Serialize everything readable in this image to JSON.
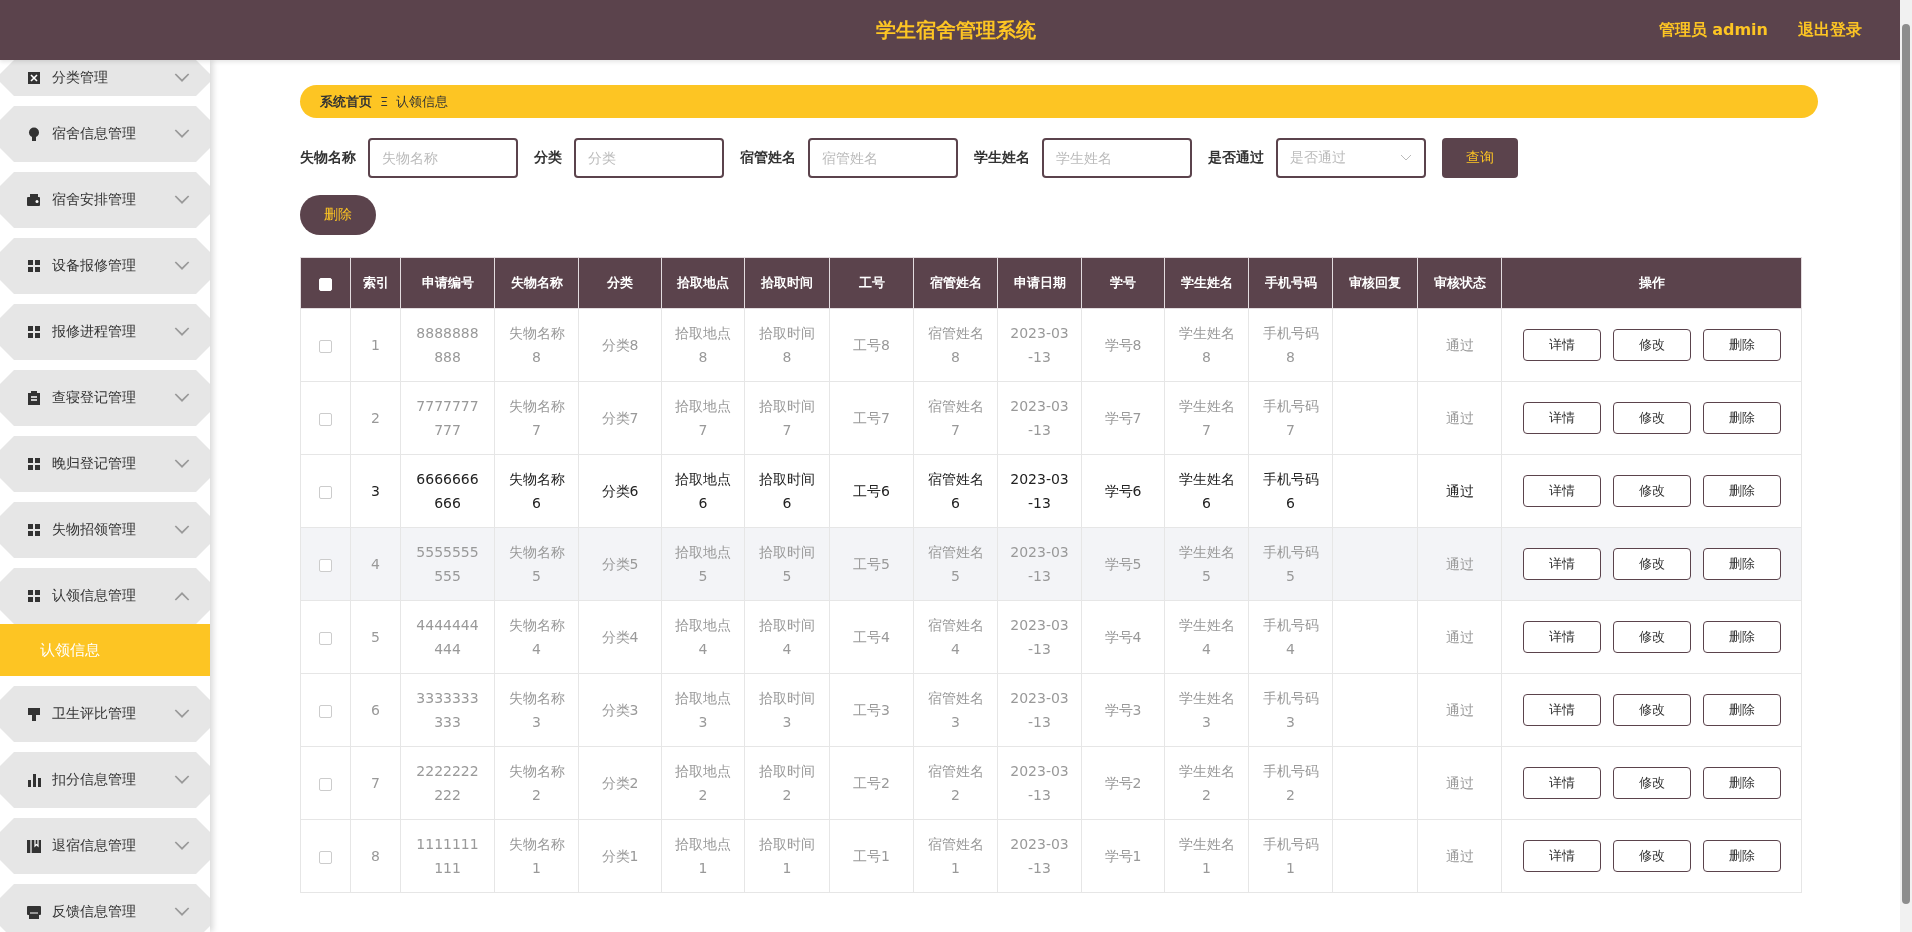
{
  "header": {
    "title": "学生宿舍管理系统",
    "user": "管理员 admin",
    "logout": "退出登录"
  },
  "sidebar": {
    "items": [
      {
        "label": "分类管理",
        "expanded": false
      },
      {
        "label": "宿舍信息管理",
        "expanded": false
      },
      {
        "label": "宿舍安排管理",
        "expanded": false
      },
      {
        "label": "设备报修管理",
        "expanded": false
      },
      {
        "label": "报修进程管理",
        "expanded": false
      },
      {
        "label": "查寝登记管理",
        "expanded": false
      },
      {
        "label": "晚归登记管理",
        "expanded": false
      },
      {
        "label": "失物招领管理",
        "expanded": false
      },
      {
        "label": "认领信息管理",
        "expanded": true,
        "children": [
          {
            "label": "认领信息",
            "selected": true
          }
        ]
      },
      {
        "label": "卫生评比管理",
        "expanded": false
      },
      {
        "label": "扣分信息管理",
        "expanded": false
      },
      {
        "label": "退宿信息管理",
        "expanded": false
      },
      {
        "label": "反馈信息管理",
        "expanded": false
      }
    ]
  },
  "breadcrumb": {
    "home": "系统首页",
    "separator": "Ξ",
    "current": "认领信息"
  },
  "filters": [
    {
      "label": "失物名称",
      "placeholder": "失物名称",
      "kind": "text"
    },
    {
      "label": "分类",
      "placeholder": "分类",
      "kind": "text"
    },
    {
      "label": "宿管姓名",
      "placeholder": "宿管姓名",
      "kind": "text"
    },
    {
      "label": "学生姓名",
      "placeholder": "学生姓名",
      "kind": "text"
    },
    {
      "label": "是否通过",
      "placeholder": "是否通过",
      "kind": "select"
    }
  ],
  "search_button": "查询",
  "delete_button": "删除",
  "table": {
    "select_all": false,
    "columns": [
      "索引",
      "申请编号",
      "失物名称",
      "分类",
      "拾取地点",
      "拾取时间",
      "工号",
      "宿管姓名",
      "申请日期",
      "学号",
      "学生姓名",
      "手机号码",
      "审核回复",
      "审核状态",
      "操作"
    ],
    "rows": [
      {
        "checked": false,
        "selected": false,
        "shaded": false,
        "cells": [
          "1",
          "8888888888",
          "失物名称8",
          "分类8",
          "拾取地点8",
          "拾取时间8",
          "工号8",
          "宿管姓名8",
          "2023-03-13",
          "学号8",
          "学生姓名8",
          "手机号码8",
          "",
          "通过"
        ],
        "actions": [
          "详情",
          "修改",
          "删除"
        ]
      },
      {
        "checked": false,
        "selected": false,
        "shaded": false,
        "cells": [
          "2",
          "7777777777",
          "失物名称7",
          "分类7",
          "拾取地点7",
          "拾取时间7",
          "工号7",
          "宿管姓名7",
          "2023-03-13",
          "学号7",
          "学生姓名7",
          "手机号码7",
          "",
          "通过"
        ],
        "actions": [
          "详情",
          "修改",
          "删除"
        ]
      },
      {
        "checked": false,
        "selected": true,
        "shaded": false,
        "cells": [
          "3",
          "6666666666",
          "失物名称6",
          "分类6",
          "拾取地点6",
          "拾取时间6",
          "工号6",
          "宿管姓名6",
          "2023-03-13",
          "学号6",
          "学生姓名6",
          "手机号码6",
          "",
          "通过"
        ],
        "actions": [
          "详情",
          "修改",
          "删除"
        ]
      },
      {
        "checked": false,
        "selected": false,
        "shaded": true,
        "cells": [
          "4",
          "5555555555",
          "失物名称5",
          "分类5",
          "拾取地点5",
          "拾取时间5",
          "工号5",
          "宿管姓名5",
          "2023-03-13",
          "学号5",
          "学生姓名5",
          "手机号码5",
          "",
          "通过"
        ],
        "actions": [
          "详情",
          "修改",
          "删除"
        ]
      },
      {
        "checked": false,
        "selected": false,
        "shaded": false,
        "cells": [
          "5",
          "4444444444",
          "失物名称4",
          "分类4",
          "拾取地点4",
          "拾取时间4",
          "工号4",
          "宿管姓名4",
          "2023-03-13",
          "学号4",
          "学生姓名4",
          "手机号码4",
          "",
          "通过"
        ],
        "actions": [
          "详情",
          "修改",
          "删除"
        ]
      },
      {
        "checked": false,
        "selected": false,
        "shaded": false,
        "cells": [
          "6",
          "3333333333",
          "失物名称3",
          "分类3",
          "拾取地点3",
          "拾取时间3",
          "工号3",
          "宿管姓名3",
          "2023-03-13",
          "学号3",
          "学生姓名3",
          "手机号码3",
          "",
          "通过"
        ],
        "actions": [
          "详情",
          "修改",
          "删除"
        ]
      },
      {
        "checked": false,
        "selected": false,
        "shaded": false,
        "cells": [
          "7",
          "2222222222",
          "失物名称2",
          "分类2",
          "拾取地点2",
          "拾取时间2",
          "工号2",
          "宿管姓名2",
          "2023-03-13",
          "学号2",
          "学生姓名2",
          "手机号码2",
          "",
          "通过"
        ],
        "actions": [
          "详情",
          "修改",
          "删除"
        ]
      },
      {
        "checked": false,
        "selected": false,
        "shaded": false,
        "cells": [
          "8",
          "1111111111",
          "失物名称1",
          "分类1",
          "拾取地点1",
          "拾取时间1",
          "工号1",
          "宿管姓名1",
          "2023-03-13",
          "学号1",
          "学生姓名1",
          "手机号码1",
          "",
          "通过"
        ],
        "actions": [
          "详情",
          "修改",
          "删除"
        ]
      }
    ]
  }
}
